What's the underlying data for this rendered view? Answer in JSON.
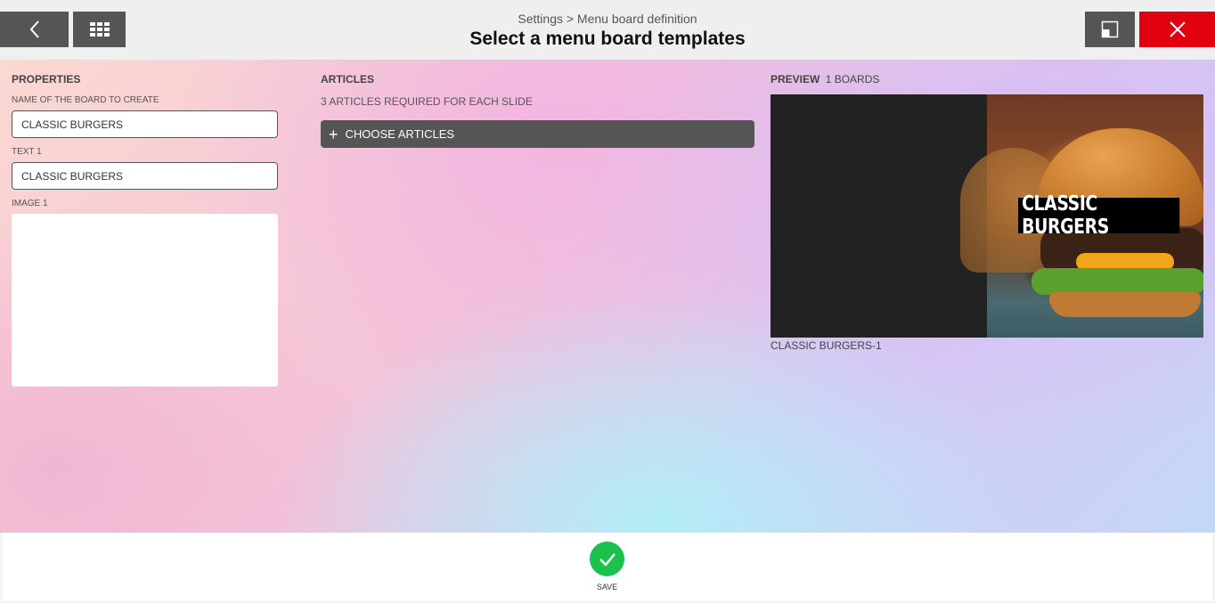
{
  "header": {
    "breadcrumb": "Settings > Menu board definition",
    "title": "Select a menu board templates",
    "back_icon": "chevron-left-icon",
    "grid_icon": "grid-icon",
    "window_icon": "window-restore-icon",
    "close_icon": "close-icon",
    "close_color": "#e0000f"
  },
  "properties": {
    "heading": "PROPERTIES",
    "name_label": "NAME OF THE BOARD TO CREATE",
    "name_value": "CLASSIC BURGERS",
    "text1_label": "TEXT 1",
    "text1_value": "CLASSIC BURGERS",
    "image1_label": "IMAGE 1"
  },
  "articles": {
    "heading": "ARTICLES",
    "requirement": "3 ARTICLES REQUIRED FOR EACH SLIDE",
    "choose_label": "CHOOSE ARTICLES"
  },
  "preview": {
    "heading": "PREVIEW",
    "count": "1 BOARDS",
    "overlay_text": "CLASSIC BURGERS",
    "caption": "CLASSIC BURGERS-1"
  },
  "footer": {
    "save_label": "SAVE",
    "save_icon": "checkmark-icon",
    "save_color": "#19c24a"
  }
}
